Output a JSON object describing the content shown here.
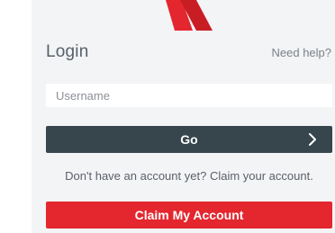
{
  "logo": {
    "icon": "brand-logo-icon",
    "color": "#e4262e"
  },
  "login": {
    "title": "Login",
    "help_label": "Need help?"
  },
  "username": {
    "placeholder": "Username",
    "value": ""
  },
  "go_button": {
    "label": "Go",
    "icon": "chevron-right-icon",
    "color": "#37454c"
  },
  "claim": {
    "prompt_text": "Don't have an account yet?",
    "link_text": "Claim your account.",
    "button_label": "Claim My Account",
    "button_color": "#e4262e"
  }
}
